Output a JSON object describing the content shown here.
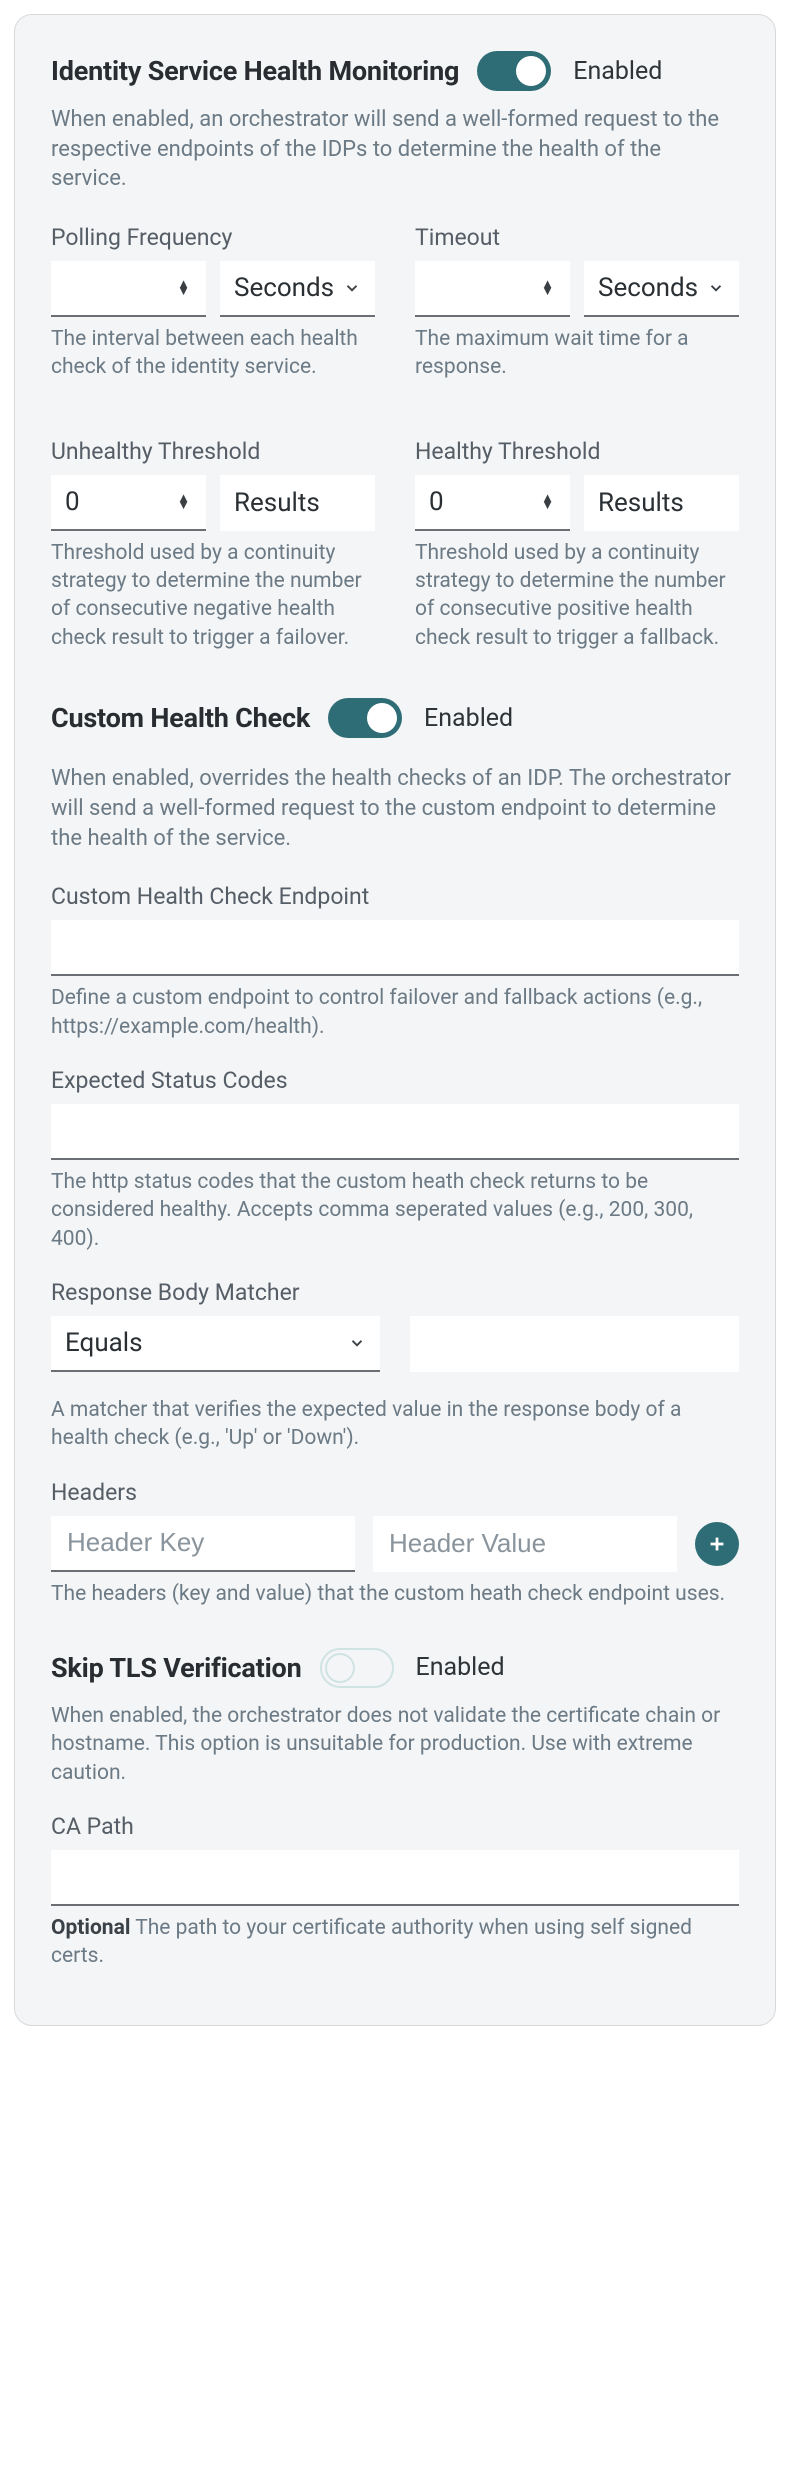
{
  "enabled_label": "Enabled",
  "dropdown_unit_seconds": "Seconds",
  "results_unit": "Results",
  "threshold_value": "0",
  "ishm": {
    "title": "Identity Service Health Monitoring",
    "enabled": true,
    "descr": "When enabled, an orchestrator will send a well-formed request to the respective endpoints of the IDPs to determine the health of the service.",
    "polling": {
      "label": "Polling Frequency",
      "help": "The interval between each health check of the identity service."
    },
    "timeout": {
      "label": "Timeout",
      "help": "The maximum wait time for a response."
    },
    "unhealthy": {
      "label": "Unhealthy Threshold",
      "help": "Threshold used by a continuity strategy to determine the number of consecutive negative health check result to trigger a failover."
    },
    "healthy": {
      "label": "Healthy Threshold",
      "help": "Threshold used by a continuity strategy to determine the number of consecutive positive health check result to trigger a fallback."
    }
  },
  "chc": {
    "title": "Custom Health Check",
    "enabled": true,
    "descr": "When enabled, overrides the health checks of an IDP. The orchestrator will send a well-formed request to the custom endpoint to determine the health of the service.",
    "endpoint": {
      "label": "Custom Health Check Endpoint",
      "help": "Define a custom endpoint to control failover and fallback actions (e.g., https://example.com/health)."
    },
    "status": {
      "label": "Expected Status Codes",
      "help": "The http status codes that the custom heath check returns to be considered healthy. Accepts comma seperated values (e.g., 200, 300, 400)."
    },
    "matcher": {
      "label": "Response Body Matcher",
      "selected": "Equals",
      "help": "A matcher that verifies the expected value in the response body of a health check (e.g., 'Up' or 'Down')."
    },
    "headers": {
      "label": "Headers",
      "key_placeholder": "Header Key",
      "val_placeholder": "Header Value",
      "help": "The headers (key and value) that the custom heath check endpoint uses."
    }
  },
  "tls": {
    "title": "Skip TLS Verification",
    "enabled": false,
    "descr": "When enabled, the orchestrator does not validate the certificate chain or hostname. This option is unsuitable for production. Use with extreme caution."
  },
  "ca": {
    "label": "CA Path",
    "help_strong": "Optional",
    "help_rest": " The path to your certificate authority when using self signed certs."
  }
}
